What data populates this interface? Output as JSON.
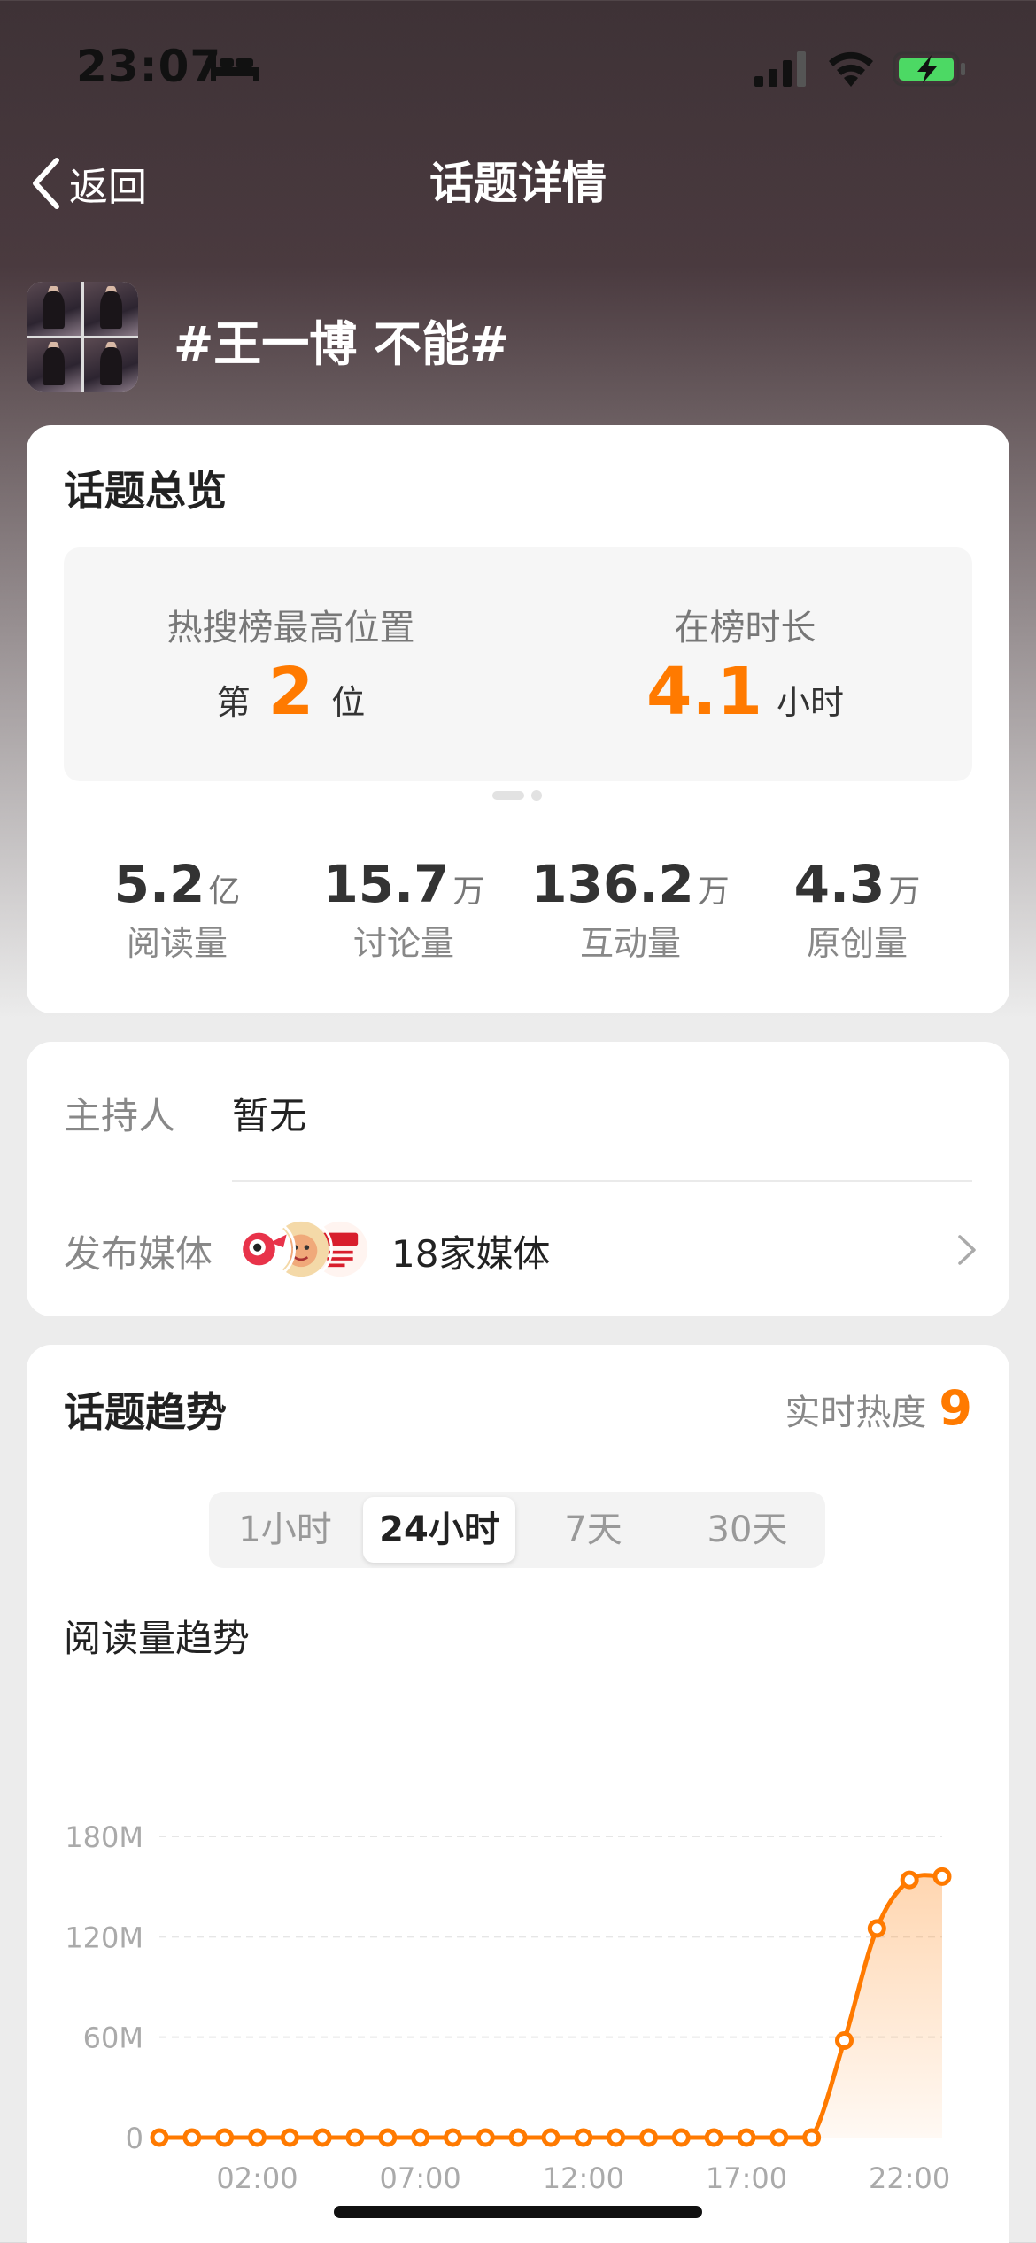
{
  "status_bar": {
    "time": "23:07"
  },
  "nav": {
    "back_label": "返回",
    "title": "话题详情"
  },
  "topic": {
    "name": "#王一博 不能#"
  },
  "overview": {
    "title": "话题总览",
    "highest_rank_label": "热搜榜最高位置",
    "rank_prefix": "第",
    "rank_value": "2",
    "rank_suffix": "位",
    "duration_label": "在榜时长",
    "duration_value": "4.1",
    "duration_unit": "小时",
    "stats": [
      {
        "value": "5.2",
        "unit": "亿",
        "label": "阅读量"
      },
      {
        "value": "15.7",
        "unit": "万",
        "label": "讨论量"
      },
      {
        "value": "136.2",
        "unit": "万",
        "label": "互动量"
      },
      {
        "value": "4.3",
        "unit": "万",
        "label": "原创量"
      }
    ]
  },
  "info": {
    "host_label": "主持人",
    "host_value": "暂无",
    "media_label": "发布媒体",
    "media_value": "18家媒体"
  },
  "trend": {
    "title": "话题趋势",
    "realtime_label": "实时热度",
    "realtime_value": "9",
    "tabs": [
      "1小时",
      "24小时",
      "7天",
      "30天"
    ],
    "active_tab": 1,
    "chart_title": "阅读量趋势"
  },
  "colors": {
    "accent": "#ff7a00"
  },
  "chart_data": {
    "type": "area",
    "title": "阅读量趋势",
    "xlabel": "",
    "ylabel": "",
    "ylim": [
      0,
      180
    ],
    "y_unit": "M",
    "y_ticks": [
      "0",
      "60M",
      "120M",
      "180M"
    ],
    "x_tick_labels": [
      "02:00",
      "07:00",
      "12:00",
      "17:00",
      "22:00"
    ],
    "x_tick_positions": [
      3,
      8,
      13,
      18,
      23
    ],
    "grid": true,
    "series": [
      {
        "values": [
          0,
          0,
          0,
          0,
          0,
          0,
          0,
          0,
          0,
          0,
          0,
          0,
          0,
          0,
          0,
          0,
          0,
          0,
          0,
          0,
          0,
          58,
          125,
          154,
          156
        ]
      }
    ]
  }
}
